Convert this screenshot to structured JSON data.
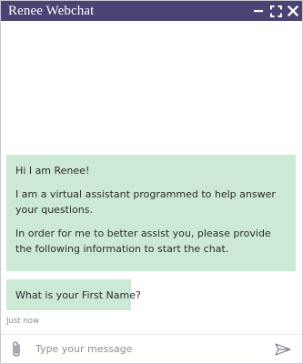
{
  "window": {
    "title": "Renee Webchat",
    "controls": [
      {
        "name": "minimize-icon",
        "glyph": "minus"
      },
      {
        "name": "maximize-icon",
        "glyph": "expand"
      },
      {
        "name": "close-icon",
        "glyph": "x"
      }
    ]
  },
  "colors": {
    "titlebar_bg": "#4a4475",
    "bubble_bg": "#cce9d6"
  },
  "messages": {
    "greeting": {
      "line1": "Hi I am Renee!",
      "line2": "I am a virtual assistant programmed to help answer your questions.",
      "line3": "In order for me to better assist you, please provide the following information to start the chat."
    },
    "question": "What is your First Name?",
    "timestamp": "Just now"
  },
  "composer": {
    "placeholder": "Type your message",
    "value": "",
    "attach_icon": "paperclip-icon",
    "send_icon": "send-icon"
  }
}
